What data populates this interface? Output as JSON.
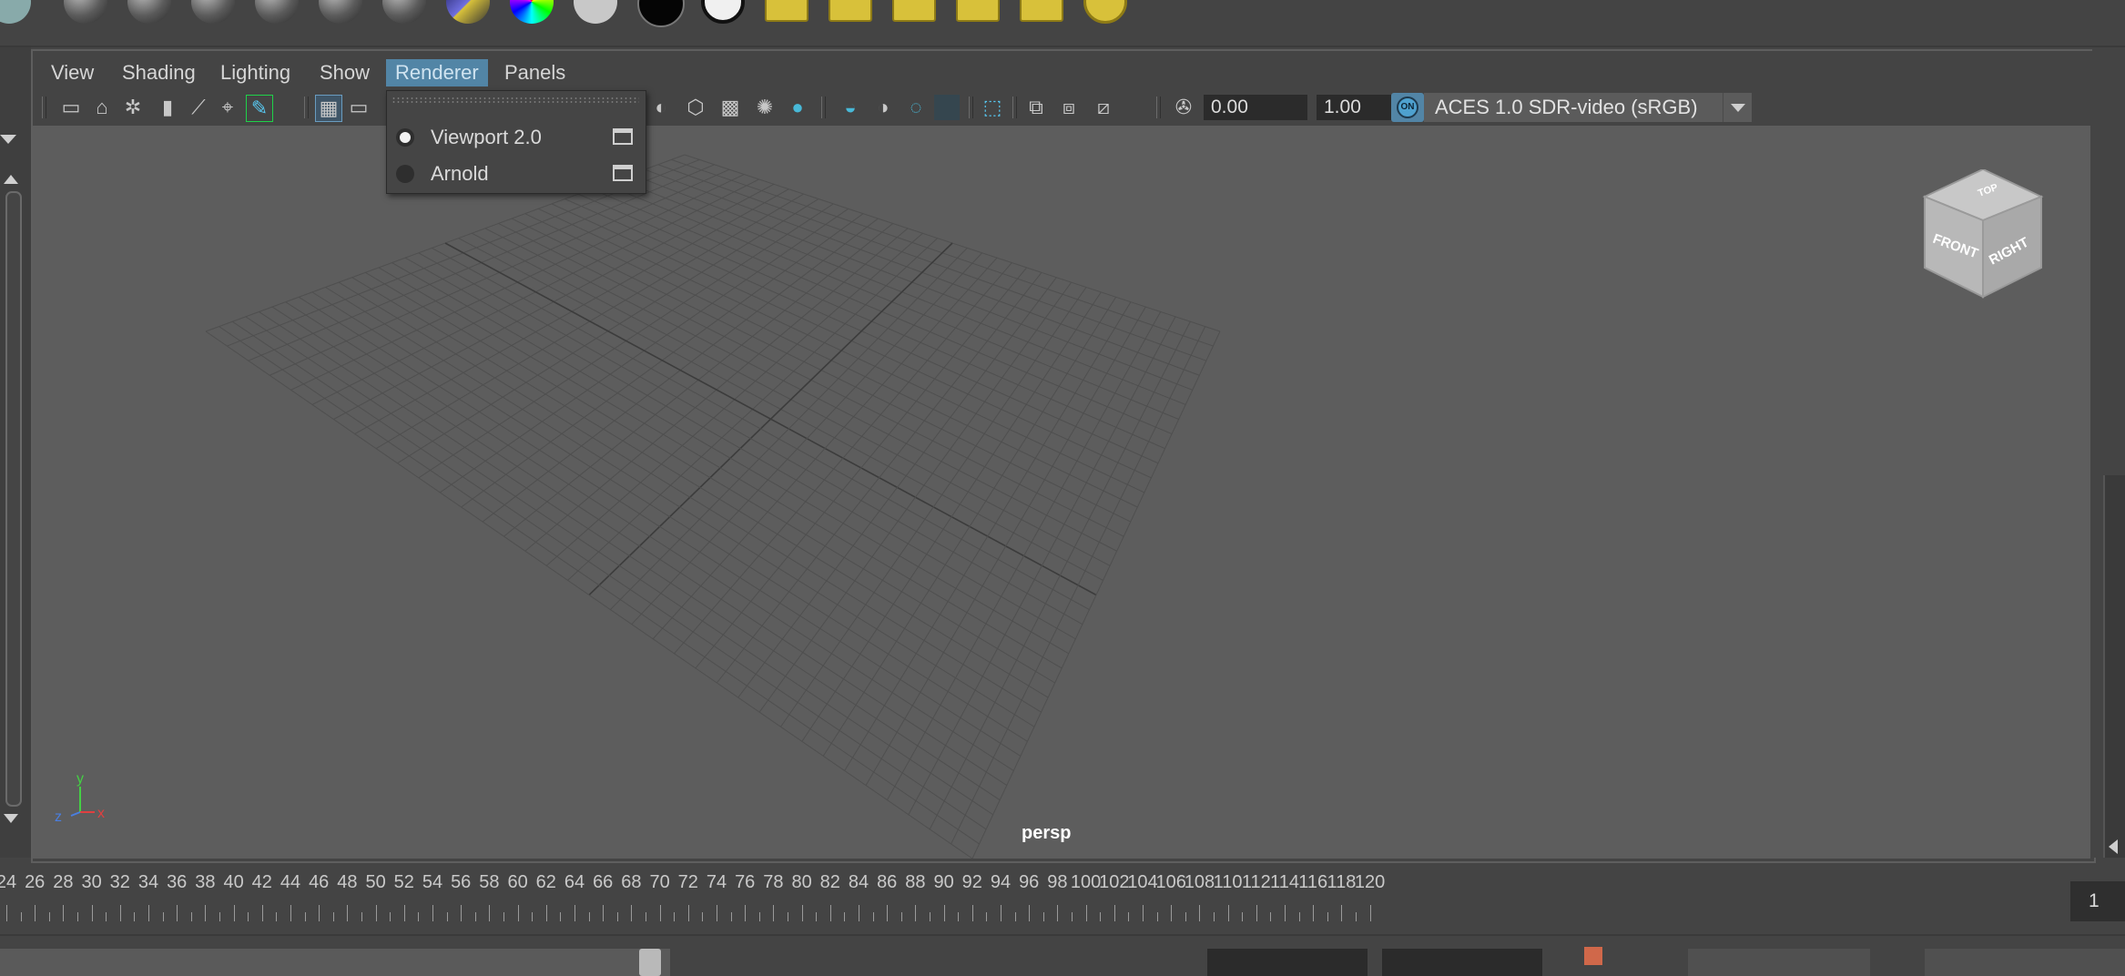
{
  "menubar": {
    "items": [
      {
        "label": "View"
      },
      {
        "label": "Shading"
      },
      {
        "label": "Lighting"
      },
      {
        "label": "Show"
      },
      {
        "label": "Renderer"
      },
      {
        "label": "Panels"
      }
    ],
    "active": "Renderer"
  },
  "toolbar": {
    "exposure_value": "0.00",
    "gamma_value": "1.00",
    "color_mgmt_badge": "ON",
    "color_space": "ACES 1.0 SDR-video (sRGB)"
  },
  "renderer_menu": {
    "items": [
      {
        "label": "Viewport 2.0",
        "selected": true
      },
      {
        "label": "Arnold",
        "selected": false
      }
    ]
  },
  "viewport": {
    "camera_label": "persp",
    "viewcube": {
      "top": "TOP",
      "front": "FRONT",
      "right": "RIGHT"
    },
    "axes": {
      "x": "x",
      "y": "y",
      "z": "z"
    }
  },
  "timeline": {
    "labels": [
      "24",
      "26",
      "28",
      "30",
      "32",
      "34",
      "36",
      "38",
      "40",
      "42",
      "44",
      "46",
      "48",
      "50",
      "52",
      "54",
      "56",
      "58",
      "60",
      "62",
      "64",
      "66",
      "68",
      "70",
      "72",
      "74",
      "76",
      "78",
      "80",
      "82",
      "84",
      "86",
      "88",
      "90",
      "92",
      "94",
      "96",
      "98",
      "100",
      "102",
      "104",
      "106",
      "108",
      "110",
      "112",
      "114",
      "116",
      "118",
      "120"
    ],
    "current_frame": "1"
  },
  "colors": {
    "accent": "#5285a6",
    "viewport_bg": "#5d5d5d",
    "ui_bg": "#444444",
    "shelf_yellow": "#d8c13a"
  }
}
